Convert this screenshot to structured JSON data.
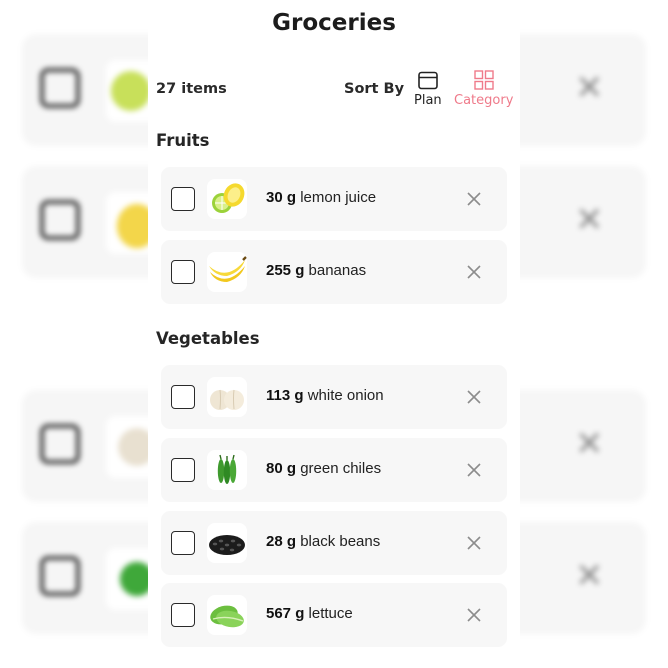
{
  "header": {
    "title": "Groceries",
    "item_count": "27 items",
    "sort_label": "Sort By",
    "sort_options": [
      {
        "label": "Plan",
        "icon": "calendar-icon",
        "selected": false
      },
      {
        "label": "Category",
        "icon": "grid-icon",
        "selected": true
      }
    ]
  },
  "sections": [
    {
      "name": "Fruits",
      "items": [
        {
          "qty": "30 g",
          "name": "lemon juice",
          "icon": "lemon-lime-image"
        },
        {
          "qty": "255 g",
          "name": "bananas",
          "icon": "banana-image"
        }
      ]
    },
    {
      "name": "Vegetables",
      "items": [
        {
          "qty": "113 g",
          "name": "white onion",
          "icon": "onion-image"
        },
        {
          "qty": "80 g",
          "name": "green chiles",
          "icon": "green-chile-image"
        },
        {
          "qty": "28 g",
          "name": "black beans",
          "icon": "black-beans-image"
        },
        {
          "qty": "567 g",
          "name": "lettuce",
          "icon": "lettuce-image"
        }
      ]
    }
  ],
  "colors": {
    "accent": "#ef7a8a",
    "card_background": "#f7f7f7",
    "text": "#1b1b1b",
    "remove_icon": "#8c8c8c"
  }
}
